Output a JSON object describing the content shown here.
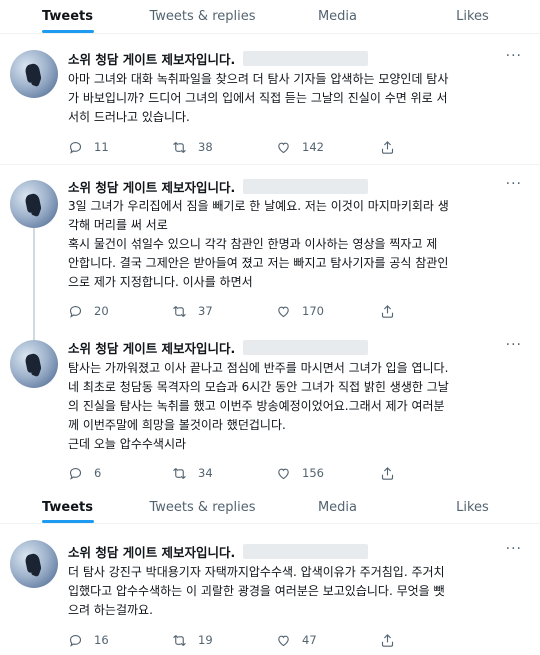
{
  "tabs": [
    {
      "label": "Tweets",
      "active": true
    },
    {
      "label": "Tweets & replies",
      "active": false
    },
    {
      "label": "Media",
      "active": false
    },
    {
      "label": "Likes",
      "active": false
    }
  ],
  "tabs_repeat": [
    {
      "label": "Tweets",
      "active": true
    },
    {
      "label": "Tweets & replies",
      "active": false
    },
    {
      "label": "Media",
      "active": false
    },
    {
      "label": "Likes",
      "active": false
    }
  ],
  "tweets": [
    {
      "name": "소위 청담 게이트 제보자입니다.",
      "more": "···",
      "lines": [
        "아마 그녀와 대화 녹취파일을 찾으려 더 탐사 기자들 압색하는 모양인데 탐사",
        "가 바보입니까? 드디어 그녀의 입에서 직접 듣는 그날의 진실이 수면 위로 서",
        "서히 드러나고 있습니다."
      ],
      "replies": "11",
      "retweets": "38",
      "likes": "142"
    },
    {
      "name": "소위 청담 게이트 제보자입니다.",
      "more": "···",
      "lines": [
        "3일 그녀가 우리집에서 짐을 빼기로 한 날예요. 저는 이것이 마지마키회라 생",
        "각해 머리를 써 서로",
        " 혹시 물건이 섞일수 있으니 각각 참관인 한명과 이사하는 영상을 찍자고 제",
        "안합니다. 결국 그제안은 받아들여 졌고 저는 빠지고 탐사기자를 공식 참관인",
        "으로 제가 지정합니다. 이사를 하면서"
      ],
      "replies": "20",
      "retweets": "37",
      "likes": "170"
    },
    {
      "name": "소위 청담 게이트 제보자입니다.",
      "more": "···",
      "lines": [
        "탐사는 가까워졌고 이사 끝나고 점심에 반주를 마시면서 그녀가 입을 엽니다.",
        "네 최초로 청담동 목격자의 모습과 6시간 동안 그녀가 직접 밝힌 생생한 그날",
        "의 진실을 탐사는 녹취를 했고 이번주 방송예정이었어요.그래서 제가 여러분",
        "께 이번주말에 희망을 볼것이라 했던겁니다.",
        "근데 오늘 압수수색시라"
      ],
      "replies": "6",
      "retweets": "34",
      "likes": "156"
    },
    {
      "name": "소위 청담 게이트 제보자입니다.",
      "more": "···",
      "lines": [
        "더 탐사 강진구 박대용기자 자택까지압수수색.  압색이유가 주거침입. 주거치",
        "입했다고 압수수색하는 이 괴랄한 광경을 여러분은 보고있습니다. 무엇을 뺏",
        "으려 하는걸까요."
      ],
      "replies": "16",
      "retweets": "19",
      "likes": "47"
    }
  ]
}
